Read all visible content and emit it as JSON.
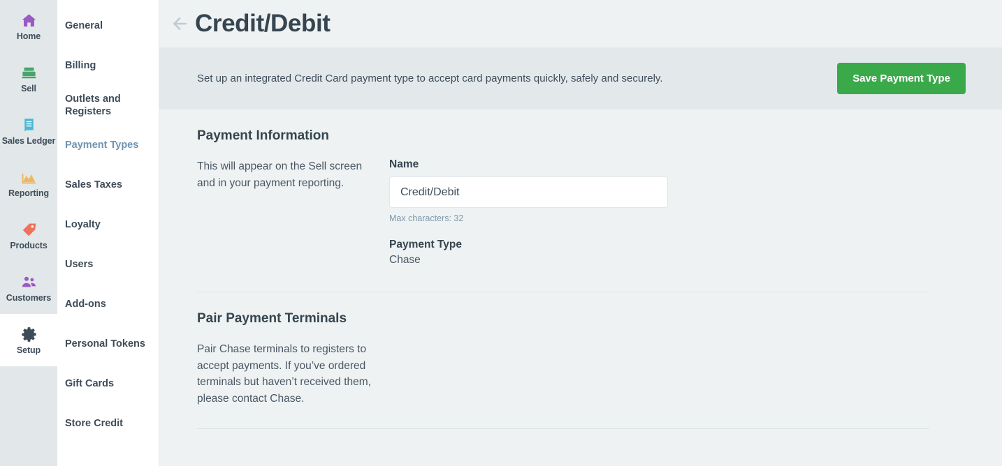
{
  "primary_nav": {
    "items": [
      {
        "label": "Home",
        "icon": "home-icon",
        "color": "#9b59c4",
        "active": false
      },
      {
        "label": "Sell",
        "icon": "register-icon",
        "color": "#49a66a",
        "active": false
      },
      {
        "label": "Sales Ledger",
        "icon": "receipt-icon",
        "color": "#4cb8d4",
        "active": false
      },
      {
        "label": "Reporting",
        "icon": "chart-icon",
        "color": "#efb860",
        "active": false
      },
      {
        "label": "Products",
        "icon": "tag-icon",
        "color": "#f0705a",
        "active": false
      },
      {
        "label": "Customers",
        "icon": "people-icon",
        "color": "#9b59c4",
        "active": false
      },
      {
        "label": "Setup",
        "icon": "gear-icon",
        "color": "#3e4c59",
        "active": true
      }
    ]
  },
  "secondary_nav": {
    "items": [
      {
        "label": "General",
        "active": false
      },
      {
        "label": "Billing",
        "active": false
      },
      {
        "label": "Outlets and Registers",
        "active": false
      },
      {
        "label": "Payment Types",
        "active": true
      },
      {
        "label": "Sales Taxes",
        "active": false
      },
      {
        "label": "Loyalty",
        "active": false
      },
      {
        "label": "Users",
        "active": false
      },
      {
        "label": "Add-ons",
        "active": false
      },
      {
        "label": "Personal Tokens",
        "active": false
      },
      {
        "label": "Gift Cards",
        "active": false
      },
      {
        "label": "Store Credit",
        "active": false
      }
    ]
  },
  "header": {
    "title": "Credit/Debit",
    "back_icon": "arrow-left-icon"
  },
  "banner": {
    "text": "Set up an integrated Credit Card payment type to accept card payments quickly, safely and securely.",
    "save_label": "Save Payment Type",
    "save_color": "#3aa94a"
  },
  "payment_information": {
    "title": "Payment Information",
    "description": "This will appear on the Sell screen and in your payment reporting.",
    "name_label": "Name",
    "name_value": "Credit/Debit",
    "name_placeholder": "Credit/Debit",
    "max_characters": "Max characters: 32",
    "payment_type_label": "Payment Type",
    "payment_type_value": "Chase"
  },
  "pair_payment_terminals": {
    "title": "Pair Payment Terminals",
    "description": "Pair Chase terminals to registers to accept payments. If you’ve ordered terminals but haven’t received them, please contact Chase."
  }
}
